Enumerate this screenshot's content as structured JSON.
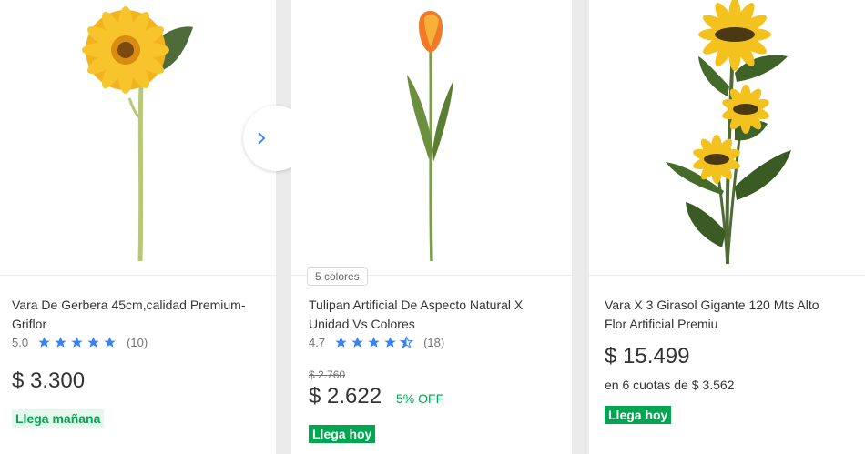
{
  "products": [
    {
      "title_line1": "Vara De Gerbera 45cm,calidad Premium-",
      "title_line2": "Griflor",
      "rating": "5.0",
      "stars": 5,
      "reviews": "(10)",
      "price": "$ 3.300",
      "shipping": "Llega mañana"
    },
    {
      "colors": "5 colores",
      "title_line1": "Tulipan Artificial De Aspecto Natural X",
      "title_line2": "Unidad Vs Colores",
      "rating": "4.7",
      "stars": 4.5,
      "reviews": "(18)",
      "old_price": "$ 2.760",
      "price": "$ 2.622",
      "discount": "5% OFF",
      "shipping": "Llega hoy"
    },
    {
      "title_line1": "Vara X 3 Girasol Gigante 120 Mts Alto",
      "title_line2": "Flor Artificial Premiu",
      "price": "$ 15.499",
      "installments": "en 6 cuotas de $ 3.562",
      "shipping": "Llega hoy"
    }
  ],
  "colors": {
    "star": "#3483fa",
    "green": "#00a650",
    "arrow": "#3483fa"
  },
  "icons": {
    "next": "chevron-right-icon",
    "star": "star-icon"
  }
}
